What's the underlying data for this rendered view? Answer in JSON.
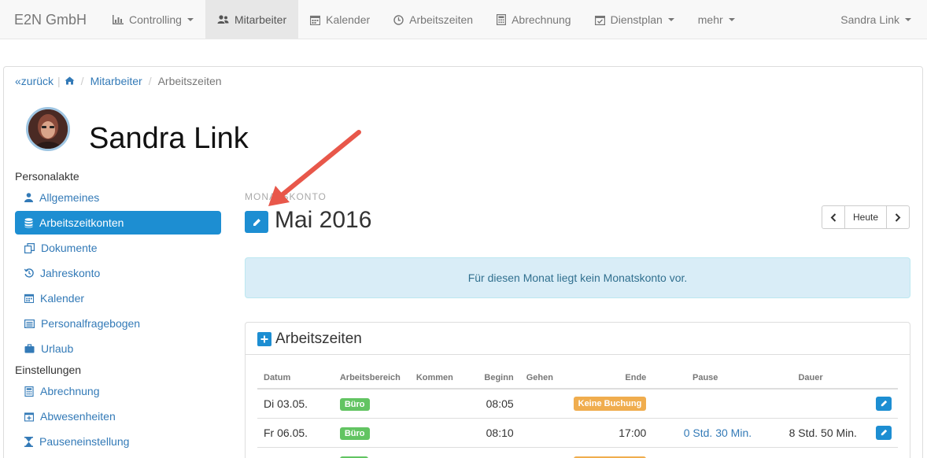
{
  "navbar": {
    "brand": "E2N GmbH",
    "items": [
      {
        "label": "Controlling",
        "icon": "bar-chart-icon",
        "dropdown": true
      },
      {
        "label": "Mitarbeiter",
        "icon": "users-icon",
        "active": true
      },
      {
        "label": "Kalender",
        "icon": "calendar-icon"
      },
      {
        "label": "Arbeitszeiten",
        "icon": "clock-icon"
      },
      {
        "label": "Abrechnung",
        "icon": "calculator-icon"
      },
      {
        "label": "Dienstplan",
        "icon": "calendar-check-icon",
        "dropdown": true
      },
      {
        "label": "mehr",
        "dropdown": true
      }
    ],
    "user": "Sandra Link"
  },
  "breadcrumb": {
    "back": "zurück",
    "back_prefix": "«",
    "items": [
      "Mitarbeiter",
      "Arbeitszeiten"
    ]
  },
  "profile": {
    "name": "Sandra Link"
  },
  "sidebar": {
    "section1": "Personalakte",
    "items1": [
      {
        "label": "Allgemeines",
        "icon": "user-icon"
      },
      {
        "label": "Arbeitszeitkonten",
        "icon": "database-icon",
        "active": true
      },
      {
        "label": "Dokumente",
        "icon": "documents-icon"
      },
      {
        "label": "Jahreskonto",
        "icon": "history-icon"
      },
      {
        "label": "Kalender",
        "icon": "calendar-icon"
      },
      {
        "label": "Personalfragebogen",
        "icon": "list-icon"
      },
      {
        "label": "Urlaub",
        "icon": "suitcase-icon"
      }
    ],
    "section2": "Einstellungen",
    "items2": [
      {
        "label": "Abrechnung",
        "icon": "calculator-icon"
      },
      {
        "label": "Abwesenheiten",
        "icon": "calendar-plus-icon"
      },
      {
        "label": "Pauseneinstellung",
        "icon": "hourglass-icon"
      }
    ]
  },
  "month": {
    "caption": "MONATSKONTO",
    "title": "Mai 2016",
    "today_button": "Heute"
  },
  "alert": {
    "text": "Für diesen Monat liegt kein Monatskonto vor."
  },
  "worktimes": {
    "title": "Arbeitszeiten",
    "columns": [
      "Datum",
      "Arbeitsbereich",
      "Kommen",
      "Beginn",
      "Gehen",
      "Ende",
      "Pause",
      "Dauer"
    ],
    "rows": [
      {
        "datum": "Di 03.05.",
        "bereich": "Büro",
        "kommen": "",
        "beginn": "08:05",
        "gehen": "",
        "ende": "Keine Buchung",
        "ende_is_label": true,
        "pause": "",
        "dauer": ""
      },
      {
        "datum": "Fr 06.05.",
        "bereich": "Büro",
        "kommen": "",
        "beginn": "08:10",
        "gehen": "",
        "ende": "17:00",
        "ende_is_label": false,
        "pause": "0 Std. 30 Min.",
        "dauer": "8 Std. 50 Min."
      }
    ]
  },
  "colors": {
    "accent": "#1d8ed2",
    "link": "#337ab7",
    "label_green": "#62c462",
    "label_orange": "#f0ad4e",
    "alert_bg": "#d9edf7",
    "annotation_arrow": "#e8574a"
  }
}
